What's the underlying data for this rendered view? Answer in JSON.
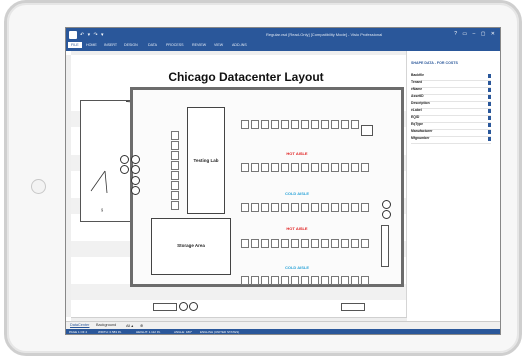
{
  "window": {
    "title": "Regular.vsd [Read-Only] [Compatibility Mode] - Visio Professional",
    "qat": "↶ ▾ ↷ ▾"
  },
  "ribbon": {
    "tabs": [
      "FILE",
      "HOME",
      "INSERT",
      "DESIGN",
      "DATA",
      "PROCESS",
      "REVIEW",
      "VIEW",
      "ADD-INS"
    ]
  },
  "document": {
    "title": "Chicago Datacenter Layout",
    "testing_lab": "Testing Lab",
    "storage_area": "Storage Area",
    "aisles": [
      "HOT AISLE",
      "COLD AISLE",
      "HOT AISLE",
      "COLD AISLE"
    ]
  },
  "shape_data": {
    "header": "SHAPE DATA - FOR COSTS",
    "fields": [
      "Backfile",
      "Tenant",
      "eName",
      "AssetID",
      "Description",
      "eLabel",
      "EQID",
      "EqType",
      "Manufacturer",
      "Mfgnumber"
    ]
  },
  "page_tabs": {
    "pages": [
      "DataCenter",
      "Background",
      "All ▴"
    ],
    "add": "⊕"
  },
  "status": {
    "page": "PAGE 1 OF 2",
    "width": "WIDTH: 0.583 IN.",
    "height": "HEIGHT: 1.112 IN.",
    "angle": "ANGLE: 180°",
    "language": "ENGLISH (UNITED STATES)"
  },
  "colors": {
    "ribbon": "#2a579a",
    "hot_aisle": "#e02020",
    "cold_aisle": "#2aa3d8"
  }
}
